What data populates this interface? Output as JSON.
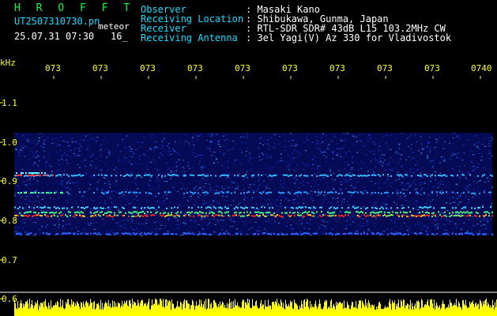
{
  "header": {
    "logo": "H R O F F T",
    "filename": "UT2507310730.pn",
    "meteor_label": "meteor",
    "datetime": "25.07.31 07:30",
    "count": "16_"
  },
  "station": {
    "observer_label": "Observer",
    "observer_value": ": Masaki Kano",
    "location_label": "Receiving Location",
    "location_value": ": Shibukawa, Gunma, Japan",
    "receiver_label": "Receiver",
    "receiver_value": ": RTL-SDR SDR# 43dB L15 103.2MHz CW",
    "antenna_label": "Receiving Antenna",
    "antenna_value": ": 3el Yagi(V) Az 330 for Vladivostok"
  },
  "axis": {
    "unit": "kHz",
    "y_ticks": [
      "1.1",
      "1.0",
      "0.9",
      "0.8",
      "0.7",
      "0.6"
    ],
    "x_ticks": [
      "073",
      "073",
      "073",
      "073",
      "073",
      "073",
      "073",
      "073",
      "073",
      "0740"
    ]
  },
  "colors": {
    "background": "#000000",
    "text": "#ffffff",
    "label_cyan": "#00e0ff",
    "logo_green": "#00ff40",
    "axis_yellow": "#ffff00",
    "signal_red": "#ff2020"
  }
}
